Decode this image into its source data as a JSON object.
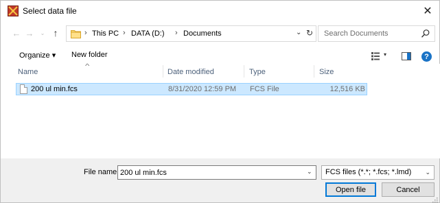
{
  "window": {
    "title": "Select data file",
    "close_glyph": "✕"
  },
  "nav": {
    "back_glyph": "←",
    "forward_glyph": "→",
    "recent_glyph": "⌄",
    "up_glyph": "↑"
  },
  "address": {
    "crumbs": [
      "This PC",
      "DATA (D:)",
      "Documents"
    ],
    "separator": "›",
    "dropdown_glyph": "⌄",
    "refresh_glyph": "↻"
  },
  "search": {
    "placeholder": "Search Documents"
  },
  "toolbar": {
    "organize_label": "Organize ▾",
    "new_folder_label": "New folder",
    "view_dropdown_glyph": "▾",
    "help_label": "?"
  },
  "columns": {
    "sort_glyph": "^",
    "name": "Name",
    "date": "Date modified",
    "type": "Type",
    "size": "Size"
  },
  "files": [
    {
      "name": "200 ul min.fcs",
      "date": "8/31/2020 12:59 PM",
      "type": "FCS File",
      "size": "12,516 KB"
    }
  ],
  "filename": {
    "label": "File name:",
    "value": "200 ul min.fcs",
    "dropdown_glyph": "⌄"
  },
  "filetype": {
    "selected": "FCS files (*.*; *.fcs; *.lmd)",
    "dropdown_glyph": "⌄"
  },
  "buttons": {
    "open": "Open file",
    "cancel": "Cancel"
  },
  "colors": {
    "selection_bg": "#cce8ff",
    "selection_border": "#99d1ff",
    "accent": "#0078d7",
    "footer_bg": "#f0f0f0"
  }
}
